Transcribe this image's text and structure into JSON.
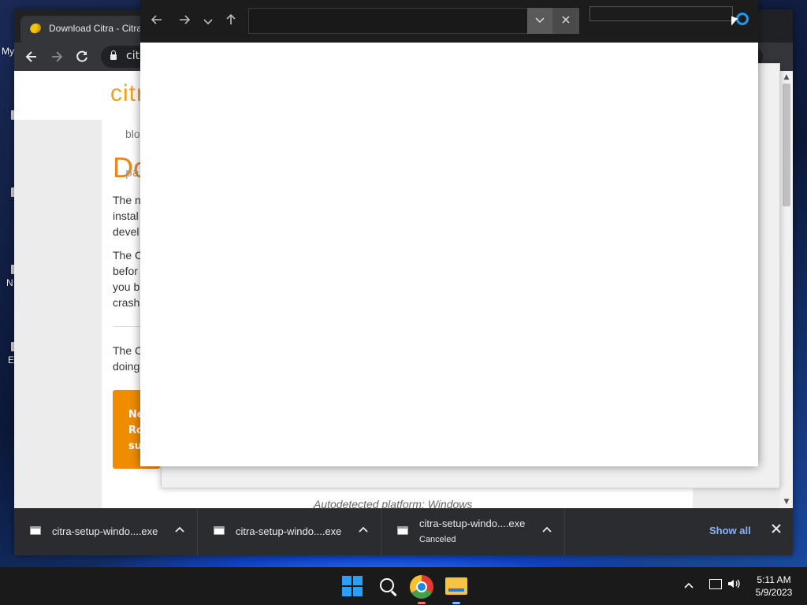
{
  "desktop": {
    "labels": [
      "My",
      "N",
      "E"
    ]
  },
  "chrome": {
    "tab_title": "Download Citra - Citra",
    "url": "citra",
    "back_icon": "arrow-left-icon",
    "forward_icon": "arrow-right-icon",
    "reload_icon": "reload-icon"
  },
  "page": {
    "logo": "citra",
    "breadcrumb": "blo",
    "heading": "Do",
    "subheading": "pa",
    "paragraph1": [
      "The n",
      "instal",
      "devel"
    ],
    "paragraph2": [
      "The C",
      "befor",
      "you b",
      "crash"
    ],
    "paragraph3": [
      "The C",
      "doing"
    ],
    "orange_box": [
      "Ne",
      "Ro",
      "su"
    ],
    "autodetect": "Autodetected platform: Windows"
  },
  "downloads": {
    "items": [
      {
        "name": "citra-setup-windo....exe",
        "status": ""
      },
      {
        "name": "citra-setup-windo....exe",
        "status": ""
      },
      {
        "name": "citra-setup-windo....exe",
        "status": "Canceled"
      }
    ],
    "show_all": "Show all"
  },
  "explorer": {
    "address_value": "",
    "search_value": ""
  },
  "taskbar": {
    "time": "5:11 AM",
    "date": "5/9/2023"
  },
  "colors": {
    "accent": "#f08c00",
    "link": "#8ab4f8",
    "windows_blue": "#2b9fff"
  }
}
